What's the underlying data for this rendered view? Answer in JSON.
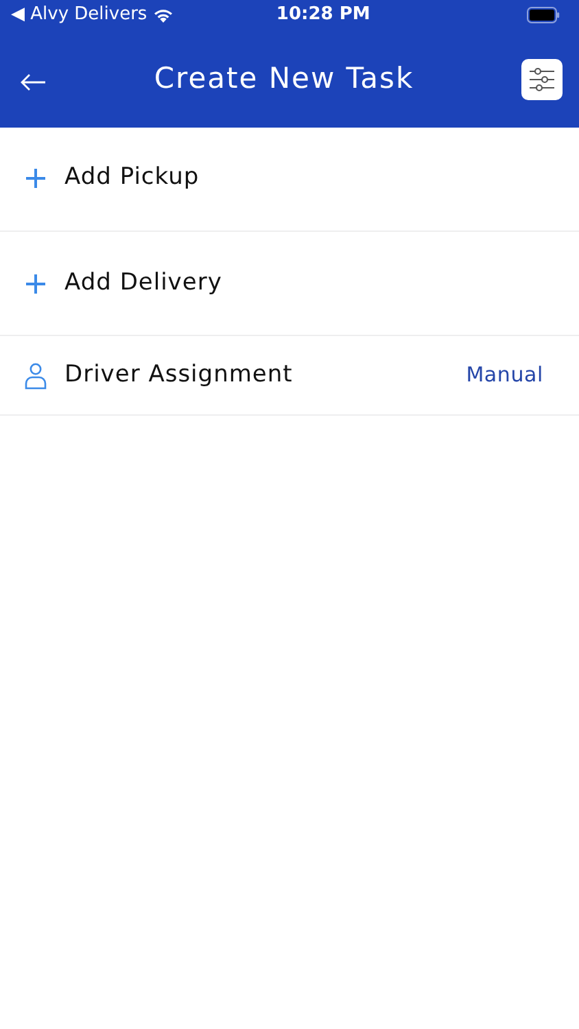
{
  "status_bar": {
    "back_app": "◀ Alvy Delivers",
    "time": "10:28 PM"
  },
  "header": {
    "title": "Create New Task"
  },
  "rows": [
    {
      "kind": "add",
      "label": "Add Pickup"
    },
    {
      "kind": "add",
      "label": "Add Delivery"
    },
    {
      "kind": "driver",
      "label": "Driver Assignment",
      "value": "Manual"
    }
  ]
}
